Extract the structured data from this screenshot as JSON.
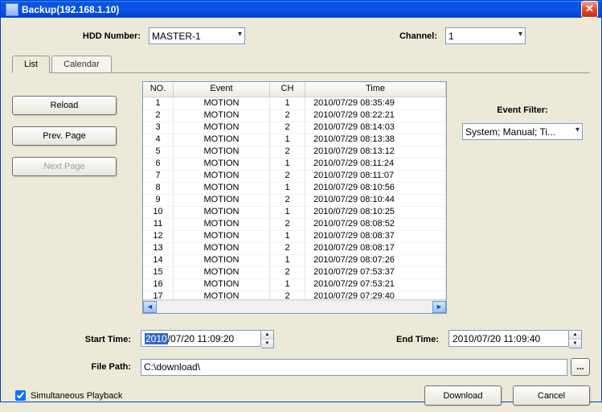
{
  "window": {
    "title": "Backup(192.168.1.10)"
  },
  "labels": {
    "hdd_number": "HDD Number:",
    "channel": "Channel:",
    "event_filter": "Event Filter:",
    "start_time": "Start Time:",
    "end_time": "End Time:",
    "file_path": "File Path:"
  },
  "selects": {
    "hdd_number": "MASTER-1",
    "channel": "1",
    "event_filter": "System; Manual; Ti..."
  },
  "tabs": {
    "list": "List",
    "calendar": "Calendar"
  },
  "buttons": {
    "reload": "Reload",
    "prev_page": "Prev. Page",
    "next_page": "Next Page",
    "download": "Download",
    "cancel": "Cancel",
    "browse": "..."
  },
  "checkbox": {
    "simultaneous_playback": "Simultaneous Playback"
  },
  "table": {
    "headers": {
      "no": "NO.",
      "event": "Event",
      "ch": "CH",
      "time": "Time"
    },
    "rows": [
      {
        "no": "1",
        "event": "MOTION",
        "ch": "1",
        "time": "2010/07/29 08:35:49"
      },
      {
        "no": "2",
        "event": "MOTION",
        "ch": "2",
        "time": "2010/07/29 08:22:21"
      },
      {
        "no": "3",
        "event": "MOTION",
        "ch": "2",
        "time": "2010/07/29 08:14:03"
      },
      {
        "no": "4",
        "event": "MOTION",
        "ch": "1",
        "time": "2010/07/29 08:13:38"
      },
      {
        "no": "5",
        "event": "MOTION",
        "ch": "2",
        "time": "2010/07/29 08:13:12"
      },
      {
        "no": "6",
        "event": "MOTION",
        "ch": "1",
        "time": "2010/07/29 08:11:24"
      },
      {
        "no": "7",
        "event": "MOTION",
        "ch": "2",
        "time": "2010/07/29 08:11:07"
      },
      {
        "no": "8",
        "event": "MOTION",
        "ch": "1",
        "time": "2010/07/29 08:10:56"
      },
      {
        "no": "9",
        "event": "MOTION",
        "ch": "2",
        "time": "2010/07/29 08:10:44"
      },
      {
        "no": "10",
        "event": "MOTION",
        "ch": "1",
        "time": "2010/07/29 08:10:25"
      },
      {
        "no": "11",
        "event": "MOTION",
        "ch": "2",
        "time": "2010/07/29 08:08:52"
      },
      {
        "no": "12",
        "event": "MOTION",
        "ch": "1",
        "time": "2010/07/29 08:08:37"
      },
      {
        "no": "13",
        "event": "MOTION",
        "ch": "2",
        "time": "2010/07/29 08:08:17"
      },
      {
        "no": "14",
        "event": "MOTION",
        "ch": "1",
        "time": "2010/07/29 08:07:26"
      },
      {
        "no": "15",
        "event": "MOTION",
        "ch": "2",
        "time": "2010/07/29 07:53:37"
      },
      {
        "no": "16",
        "event": "MOTION",
        "ch": "1",
        "time": "2010/07/29 07:53:21"
      },
      {
        "no": "17",
        "event": "MOTION",
        "ch": "2",
        "time": "2010/07/29 07:29:40"
      }
    ]
  },
  "times": {
    "start_selected": "2010",
    "start_rest": "/07/20 11:09:20",
    "end": "2010/07/20 11:09:40"
  },
  "file_path": "C:\\download\\"
}
